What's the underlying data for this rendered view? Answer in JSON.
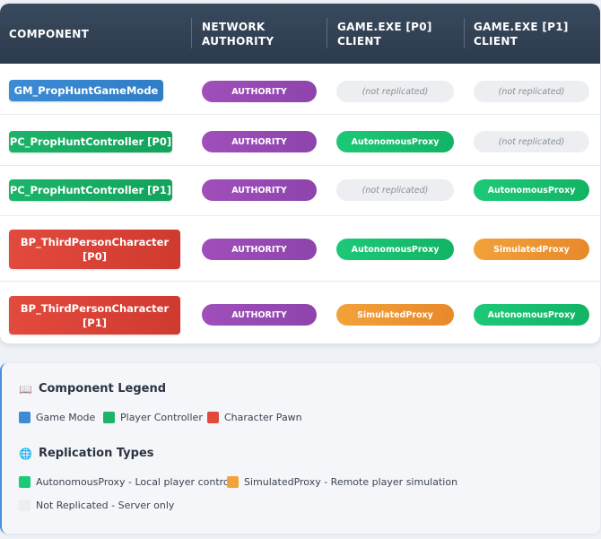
{
  "header": {
    "col_component": "COMPONENT",
    "col_authority_1": "NETWORK",
    "col_authority_2": "AUTHORITY",
    "col_p0_1": "GAME.EXE [P0]",
    "col_p0_2": "CLIENT",
    "col_p1_1": "GAME.EXE [P1]",
    "col_p1_2": "CLIENT"
  },
  "rows": [
    {
      "component_1": "GM_PropHuntGameMode",
      "component_2": "",
      "type": "game-mode",
      "authority": "AUTHORITY",
      "p0": "(not replicated)",
      "p1": "(not replicated)"
    },
    {
      "component_1": "PC_PropHuntController [P0]",
      "component_2": "",
      "type": "player-controller",
      "authority": "AUTHORITY",
      "p0": "AutonomousProxy",
      "p1": "(not replicated)"
    },
    {
      "component_1": "PC_PropHuntController [P1]",
      "component_2": "",
      "type": "player-controller",
      "authority": "AUTHORITY",
      "p0": "(not replicated)",
      "p1": "AutonomousProxy"
    },
    {
      "component_1": "BP_ThirdPersonCharacter",
      "component_2": "[P0]",
      "type": "character-pawn",
      "authority": "AUTHORITY",
      "p0": "AutonomousProxy",
      "p1": "SimulatedProxy"
    },
    {
      "component_1": "BP_ThirdPersonCharacter",
      "component_2": "[P1]",
      "type": "character-pawn",
      "authority": "AUTHORITY",
      "p0": "SimulatedProxy",
      "p1": "AutonomousProxy"
    }
  ],
  "legend": {
    "component_title": "Component Legend",
    "component_icon": "open-book-icon",
    "component_items": [
      {
        "label": "Game Mode",
        "color": "#3d8bd3"
      },
      {
        "label": "Player Controller",
        "color": "#1bb46a"
      },
      {
        "label": "Character Pawn",
        "color": "#e34a3e"
      }
    ],
    "replication_title": "Replication Types",
    "replication_icon": "globe-icon",
    "replication_items": [
      {
        "label": "AutonomousProxy - Local player control",
        "color": "#1cc977"
      },
      {
        "label": "SimulatedProxy - Remote player simulation",
        "color": "#f2a23a"
      },
      {
        "label": "Not Replicated - Server only",
        "color": "#eceef1"
      }
    ]
  },
  "colors": {
    "header_bg": "#2b3a4c",
    "authority": "#8e44ad",
    "autonomous": "#12b464",
    "simulated": "#e8892a",
    "not_replicated": "#eceef1"
  }
}
